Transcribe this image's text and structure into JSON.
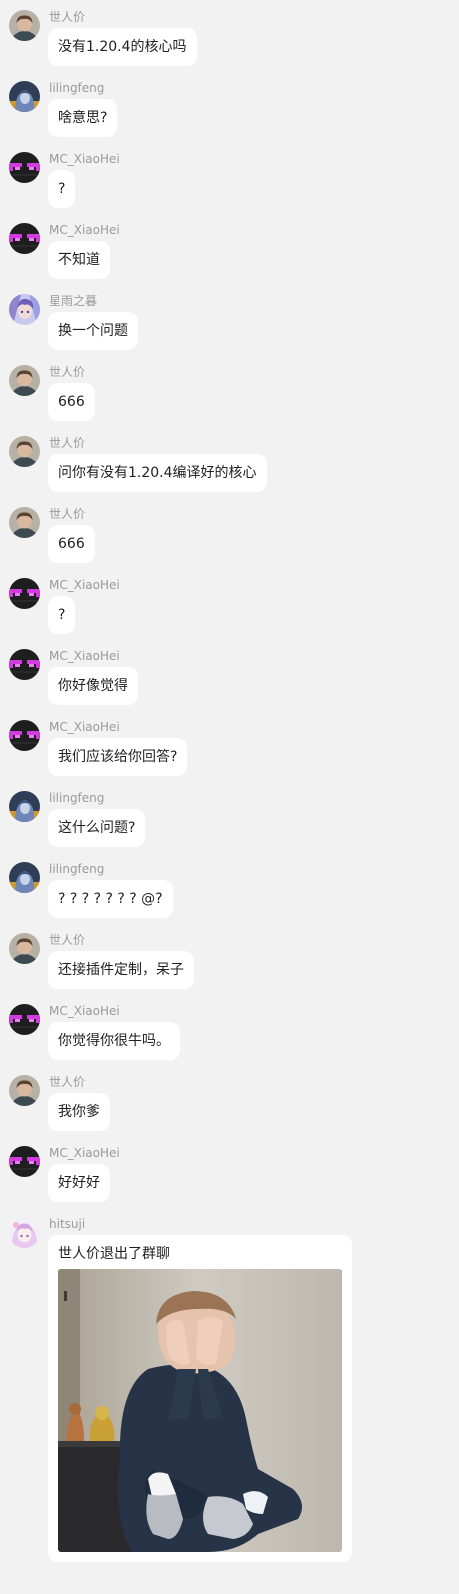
{
  "messages": [
    {
      "sender": "世人价",
      "text": "没有1.20.4的核心吗",
      "avatar": "child-avatar-icon"
    },
    {
      "sender": "lilingfeng",
      "text": "啥意思?",
      "avatar": "hooded-figure-avatar-icon"
    },
    {
      "sender": "MC_XiaoHei",
      "text": "?",
      "avatar": "enderman-face-avatar-icon"
    },
    {
      "sender": "MC_XiaoHei",
      "text": "不知道",
      "avatar": "enderman-face-avatar-icon"
    },
    {
      "sender": "星雨之暮",
      "text": "换一个问题",
      "avatar": "anime-girl-avatar-icon"
    },
    {
      "sender": "世人价",
      "text": "666",
      "avatar": "child-avatar-icon"
    },
    {
      "sender": "世人价",
      "text": "问你有没有1.20.4编译好的核心",
      "avatar": "child-avatar-icon"
    },
    {
      "sender": "世人价",
      "text": "666",
      "avatar": "child-avatar-icon"
    },
    {
      "sender": "MC_XiaoHei",
      "text": "?",
      "avatar": "enderman-face-avatar-icon"
    },
    {
      "sender": "MC_XiaoHei",
      "text": "你好像觉得",
      "avatar": "enderman-face-avatar-icon"
    },
    {
      "sender": "MC_XiaoHei",
      "text": "我们应该给你回答?",
      "avatar": "enderman-face-avatar-icon"
    },
    {
      "sender": "lilingfeng",
      "text": "这什么问题?",
      "avatar": "hooded-figure-avatar-icon"
    },
    {
      "sender": "lilingfeng",
      "text": "? ? ? ? ? ? ? @?",
      "avatar": "hooded-figure-avatar-icon"
    },
    {
      "sender": "世人价",
      "text": "还接插件定制，呆子",
      "avatar": "child-avatar-icon"
    },
    {
      "sender": "MC_XiaoHei",
      "text": "你觉得你很牛吗。",
      "avatar": "enderman-face-avatar-icon"
    },
    {
      "sender": "世人价",
      "text": "我你爹",
      "avatar": "child-avatar-icon"
    },
    {
      "sender": "MC_XiaoHei",
      "text": "好好好",
      "avatar": "enderman-face-avatar-icon"
    },
    {
      "sender": "hitsuji",
      "text": "世人价退出了群聊",
      "avatar": "pink-anime-avatar-icon",
      "image": "child-covering-face-photo"
    }
  ],
  "colors": {
    "background": "#f2f2f2",
    "bubble": "#ffffff",
    "sender_name": "#9a9a9a",
    "message_text": "#1f1f1f"
  }
}
